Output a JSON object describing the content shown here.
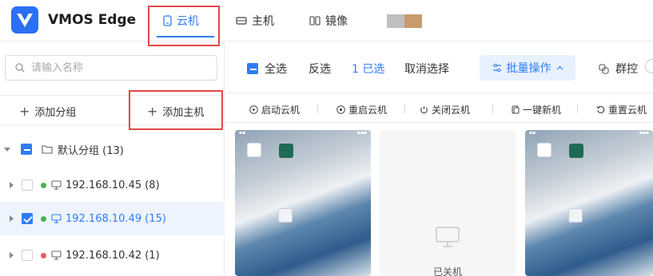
{
  "brand": {
    "name": "VMOS Edge"
  },
  "nav": {
    "tabs": [
      {
        "label": "云机",
        "active": true
      },
      {
        "label": "主机",
        "active": false
      },
      {
        "label": "镜像",
        "active": false
      }
    ]
  },
  "sidebar": {
    "search_placeholder": "请输入名称",
    "add_group": "添加分组",
    "add_host": "添加主机",
    "group": {
      "label": "默认分组 (13)"
    },
    "hosts": [
      {
        "label": "192.168.10.45 (8)",
        "status_color": "#4caf50",
        "checked": false,
        "selected": false
      },
      {
        "label": "192.168.10.49 (15)",
        "status_color": "#4caf50",
        "checked": true,
        "selected": true
      },
      {
        "label": "192.168.10.42 (1)",
        "status_color": "#e35d5d",
        "checked": false,
        "selected": false
      }
    ]
  },
  "toolbar": {
    "select_all": "全选",
    "invert": "反选",
    "selected_count": "1 已选",
    "cancel_select": "取消选择",
    "batch": "批量操作",
    "group_control": "群控"
  },
  "actions": {
    "start": "启动云机",
    "restart": "重启云机",
    "shutdown": "关闭云机",
    "new": "一键新机",
    "reset": "重置云机"
  },
  "cards": {
    "off_label": "已关机"
  },
  "colors": {
    "accent": "#2f7df6",
    "highlight": "#e04848"
  }
}
